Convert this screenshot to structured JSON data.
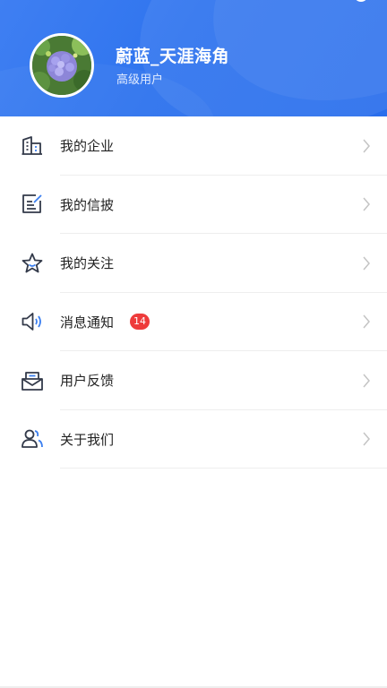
{
  "profile": {
    "username": "蔚蓝_天涯海角",
    "level": "高级用户"
  },
  "colors": {
    "header_blue": "#2f74ee",
    "badge_red": "#ee3b3b",
    "icon_dark": "#333a4a",
    "icon_accent": "#3b7ff0"
  },
  "menu": [
    {
      "label": "我的企业",
      "icon": "building-icon"
    },
    {
      "label": "我的信披",
      "icon": "document-edit-icon"
    },
    {
      "label": "我的关注",
      "icon": "star-icon"
    },
    {
      "label": "消息通知",
      "icon": "speaker-icon",
      "badge": "14"
    },
    {
      "label": "用户反馈",
      "icon": "mail-icon"
    },
    {
      "label": "关于我们",
      "icon": "users-icon"
    }
  ]
}
